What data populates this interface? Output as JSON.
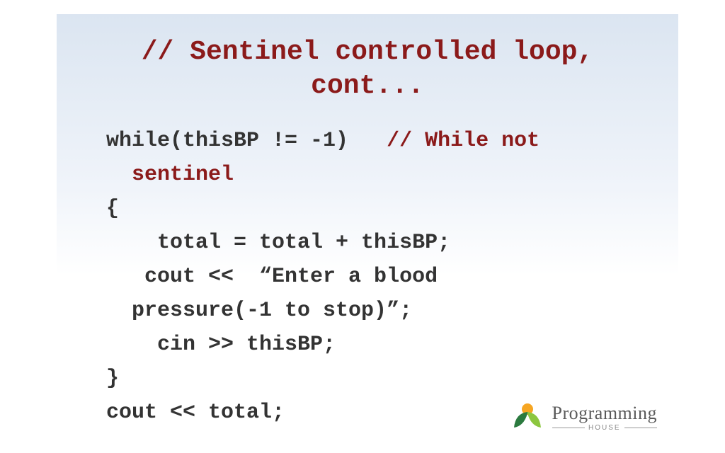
{
  "title": "// Sentinel controlled loop, cont...",
  "code": {
    "l1a": "while(thisBP != -1)   ",
    "l1b": "// While not",
    "l2": "  sentinel",
    "l3": "{",
    "l4": "    total = total + thisBP;",
    "l5": "   cout <<  “Enter a blood",
    "l6": "  pressure(-1 to stop)”;",
    "l7": "    cin >> thisBP;",
    "l8": "}",
    "l9": "cout << total;"
  },
  "logo": {
    "main": "Programming",
    "sub": "HOUSE"
  }
}
